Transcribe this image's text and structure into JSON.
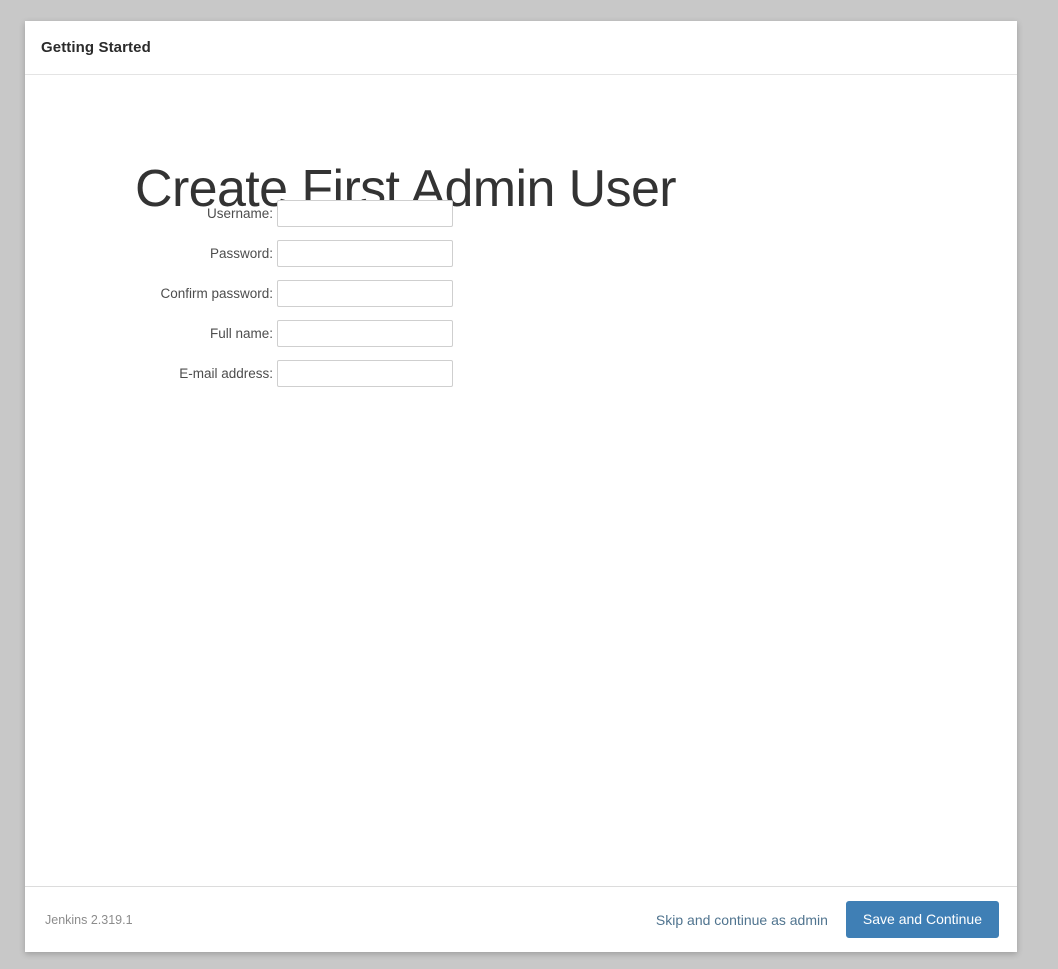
{
  "header": {
    "title": "Getting Started"
  },
  "main": {
    "title": "Create First Admin User",
    "fields": [
      {
        "label": "Username:",
        "value": "",
        "placeholder": ""
      },
      {
        "label": "Password:",
        "value": "",
        "placeholder": ""
      },
      {
        "label": "Confirm password:",
        "value": "",
        "placeholder": ""
      },
      {
        "label": "Full name:",
        "value": "",
        "placeholder": ""
      },
      {
        "label": "E-mail address:",
        "value": "",
        "placeholder": ""
      }
    ]
  },
  "footer": {
    "version": "Jenkins 2.319.1",
    "skip_label": "Skip and continue as admin",
    "save_label": "Save and Continue"
  },
  "colors": {
    "page_background": "#c8c8c8",
    "card_background": "#ffffff",
    "primary_button": "#3f7fb5",
    "link": "#50748f",
    "title_text": "#333333",
    "muted_text": "#8c8c8c",
    "field_border": "#cfcfcf"
  }
}
